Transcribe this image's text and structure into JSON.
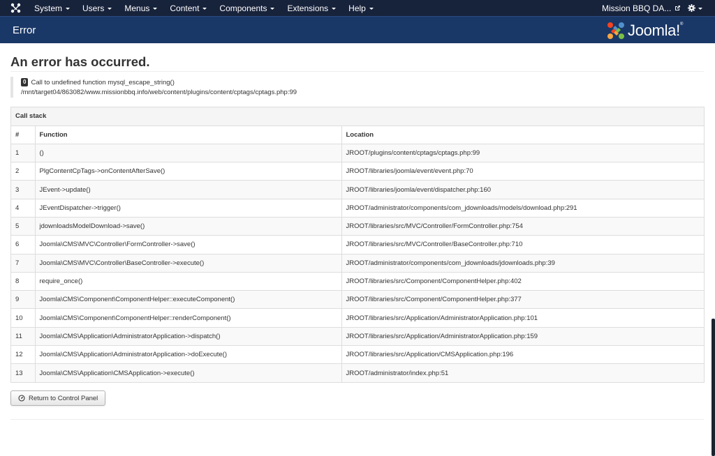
{
  "navbar": {
    "menu": [
      {
        "label": "System"
      },
      {
        "label": "Users"
      },
      {
        "label": "Menus"
      },
      {
        "label": "Content"
      },
      {
        "label": "Components"
      },
      {
        "label": "Extensions"
      },
      {
        "label": "Help"
      }
    ],
    "site_name": "Mission BBQ DA...",
    "icons": {
      "logo": "joomla-icon",
      "external": "external-link-icon",
      "settings": "gear-icon"
    }
  },
  "subheader": {
    "title": "Error",
    "brand_text": "Joomla!",
    "brand_reg": "®"
  },
  "error": {
    "heading": "An error has occurred.",
    "code": "0",
    "message": "Call to undefined function mysql_escape_string()",
    "path": "/mnt/target04/863082/www.missionbbq.info/web/content/plugins/content/cptags/cptags.php:99"
  },
  "call_stack": {
    "caption": "Call stack",
    "columns": [
      "#",
      "Function",
      "Location"
    ],
    "rows": [
      {
        "num": "1",
        "function": "()",
        "location": "JROOT/plugins/content/cptags/cptags.php:99"
      },
      {
        "num": "2",
        "function": "PlgContentCpTags->onContentAfterSave()",
        "location": "JROOT/libraries/joomla/event/event.php:70"
      },
      {
        "num": "3",
        "function": "JEvent->update()",
        "location": "JROOT/libraries/joomla/event/dispatcher.php:160"
      },
      {
        "num": "4",
        "function": "JEventDispatcher->trigger()",
        "location": "JROOT/administrator/components/com_jdownloads/models/download.php:291"
      },
      {
        "num": "5",
        "function": "jdownloadsModelDownload->save()",
        "location": "JROOT/libraries/src/MVC/Controller/FormController.php:754"
      },
      {
        "num": "6",
        "function": "Joomla\\CMS\\MVC\\Controller\\FormController->save()",
        "location": "JROOT/libraries/src/MVC/Controller/BaseController.php:710"
      },
      {
        "num": "7",
        "function": "Joomla\\CMS\\MVC\\Controller\\BaseController->execute()",
        "location": "JROOT/administrator/components/com_jdownloads/jdownloads.php:39"
      },
      {
        "num": "8",
        "function": "require_once()",
        "location": "JROOT/libraries/src/Component/ComponentHelper.php:402"
      },
      {
        "num": "9",
        "function": "Joomla\\CMS\\Component\\ComponentHelper::executeComponent()",
        "location": "JROOT/libraries/src/Component/ComponentHelper.php:377"
      },
      {
        "num": "10",
        "function": "Joomla\\CMS\\Component\\ComponentHelper::renderComponent()",
        "location": "JROOT/libraries/src/Application/AdministratorApplication.php:101"
      },
      {
        "num": "11",
        "function": "Joomla\\CMS\\Application\\AdministratorApplication->dispatch()",
        "location": "JROOT/libraries/src/Application/AdministratorApplication.php:159"
      },
      {
        "num": "12",
        "function": "Joomla\\CMS\\Application\\AdministratorApplication->doExecute()",
        "location": "JROOT/libraries/src/Application/CMSApplication.php:196"
      },
      {
        "num": "13",
        "function": "Joomla\\CMS\\Application\\CMSApplication->execute()",
        "location": "JROOT/administrator/index.php:51"
      }
    ]
  },
  "actions": {
    "return_label": "Return to Control Panel",
    "return_icon": "dashboard-icon"
  },
  "colors": {
    "navbar_bg": "#17223b",
    "subheader_bg": "#1a3867",
    "badge_bg": "#333333"
  }
}
